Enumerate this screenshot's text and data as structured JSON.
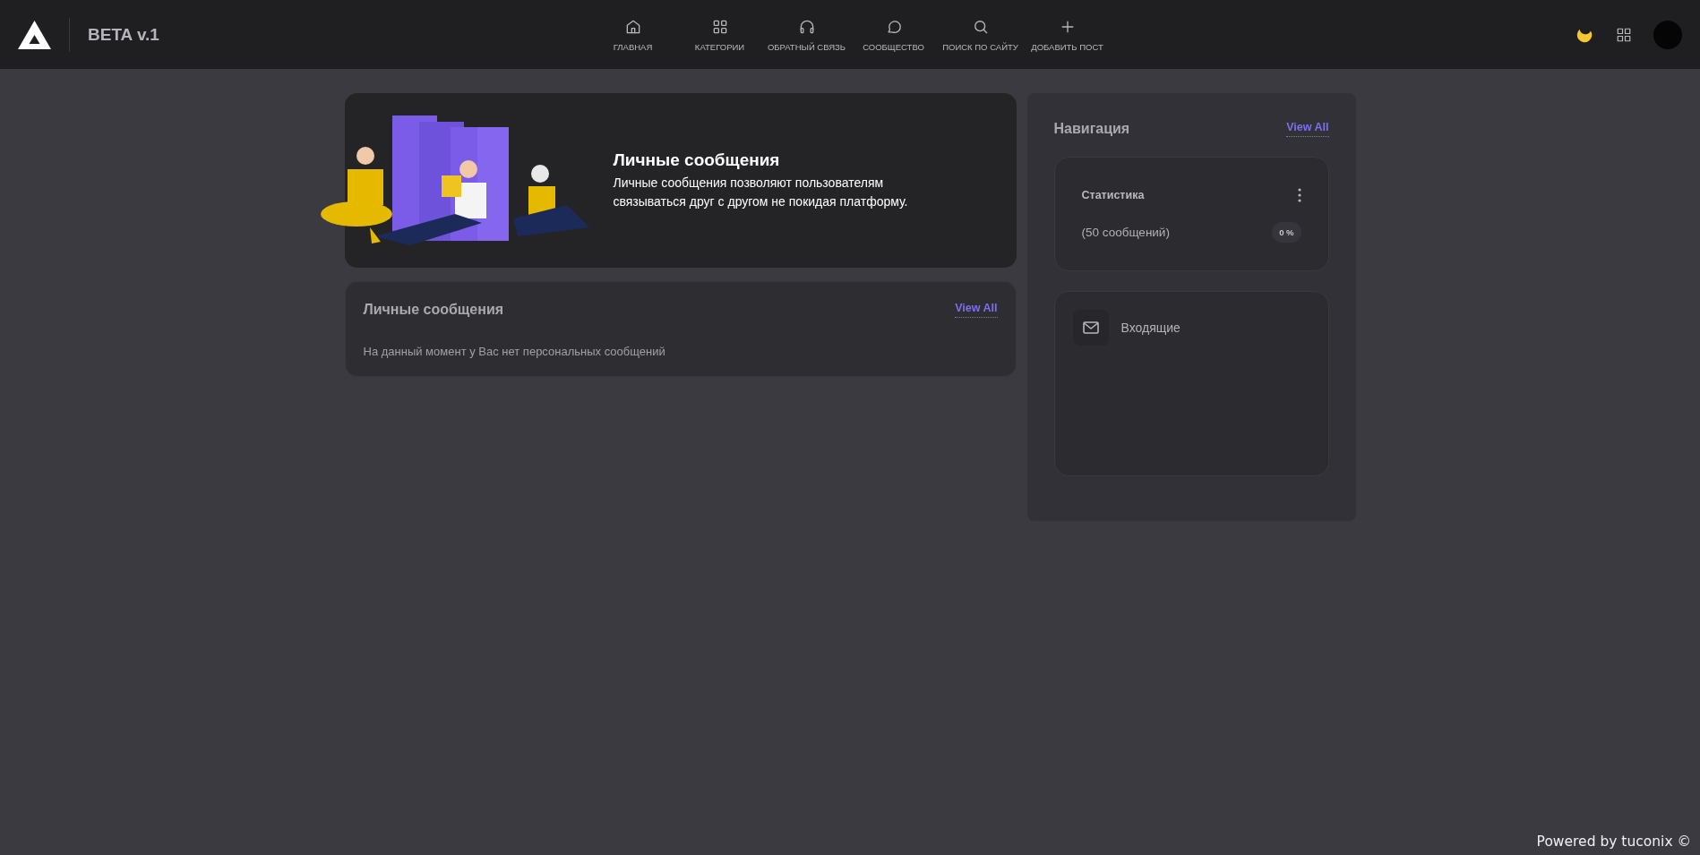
{
  "header": {
    "brand": "BETA v.1",
    "nav": [
      {
        "kind": "home",
        "label": "ГЛАВНАЯ"
      },
      {
        "kind": "grid",
        "label": "КАТЕГОРИИ"
      },
      {
        "kind": "headphones",
        "label": "ОБРАТНЫЙ СВЯЗЬ"
      },
      {
        "kind": "chat",
        "label": "СООБЩЕСТВО"
      },
      {
        "kind": "search",
        "label": "ПОИСК ПО САЙТУ"
      },
      {
        "kind": "plus",
        "label": "ДОБАВИТЬ ПОСТ"
      }
    ]
  },
  "hero": {
    "title": "Личные сообщения",
    "text": "Личные сообщения позволяют пользователям связываться друг с другом не покидая платформу."
  },
  "messages": {
    "title": "Личные сообщения",
    "link": "View All",
    "empty": "На данный момент у Вас нет персональных сообщений"
  },
  "navigation": {
    "title": "Навигация",
    "link": "View All",
    "stats": {
      "title": "Статистика",
      "count": "(50 сообщений)",
      "percent": "0 %"
    },
    "items": [
      {
        "label": "Входящие"
      }
    ]
  },
  "footer": "Powered by tuconix ©"
}
